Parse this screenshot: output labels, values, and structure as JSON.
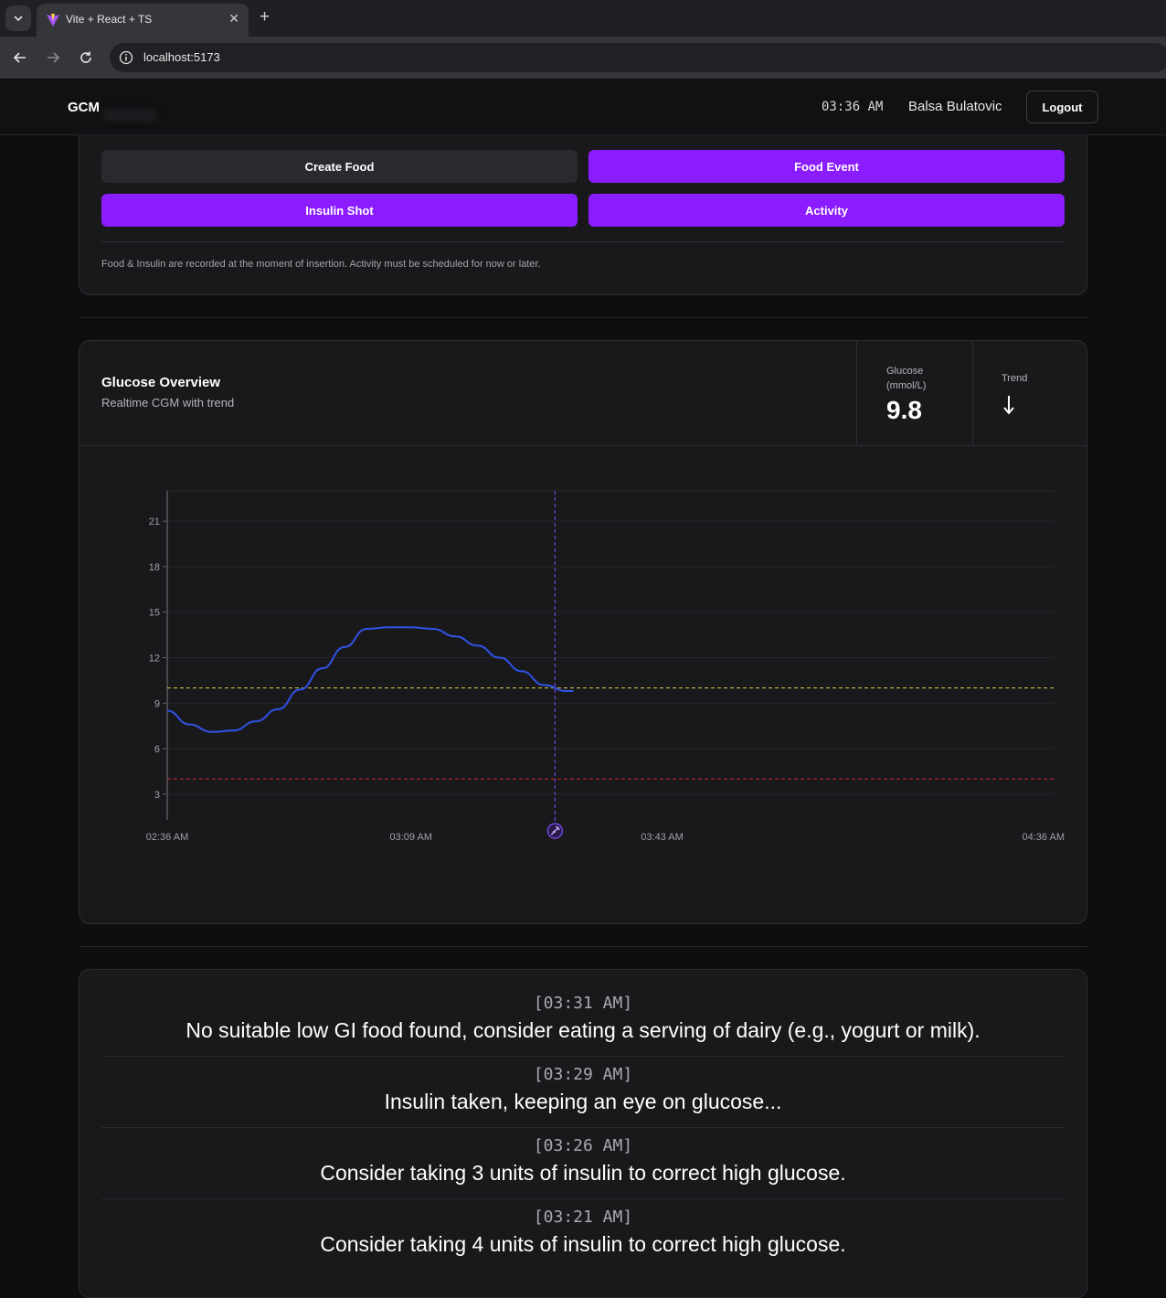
{
  "browser": {
    "tab_title": "Vite + React + TS",
    "url": "localhost:5173"
  },
  "header": {
    "brand": "GCM",
    "time": "03:36 AM",
    "user": "Balsa Bulatovic",
    "logout_label": "Logout"
  },
  "actions": {
    "create_food": "Create Food",
    "food_event": "Food Event",
    "insulin_shot": "Insulin Shot",
    "activity": "Activity",
    "note": "Food & Insulin are recorded at the moment of insertion. Activity must be scheduled for now or later."
  },
  "glucose_overview": {
    "title": "Glucose Overview",
    "subtitle": "Realtime CGM with trend",
    "glucose_label_line1": "Glucose",
    "glucose_label_line2": "(mmol/L)",
    "glucose_value": "9.8",
    "trend_label": "Trend",
    "trend_icon": "arrow-down-icon"
  },
  "chart_data": {
    "type": "line",
    "title": "",
    "xlabel": "",
    "ylabel": "",
    "x_tick_labels": [
      "02:36 AM",
      "03:09 AM",
      "03:43 AM",
      "04:36 AM"
    ],
    "x_tick_minutes": [
      0,
      33,
      67,
      120
    ],
    "y_ticks": [
      3,
      6,
      9,
      12,
      15,
      18,
      21
    ],
    "ylim": [
      1.3,
      23
    ],
    "xlim_minutes": [
      0,
      120
    ],
    "grid": true,
    "series": [
      {
        "color": "#2f52e6",
        "x_minutes": [
          0,
          3,
          6,
          9,
          12,
          15,
          18,
          21,
          24,
          27,
          30,
          33,
          36,
          39,
          42,
          45,
          48,
          51,
          54,
          55
        ],
        "values": [
          8.5,
          7.6,
          7.1,
          7.2,
          7.8,
          8.6,
          9.9,
          11.3,
          12.7,
          13.9,
          14.0,
          14.0,
          13.9,
          13.4,
          12.8,
          12.0,
          11.1,
          10.2,
          9.8,
          9.8
        ]
      }
    ],
    "reference_lines": [
      {
        "kind": "high",
        "value": 10,
        "color": "#e6c84a"
      },
      {
        "kind": "low",
        "value": 4,
        "color": "#d02a2a"
      }
    ],
    "now_marker": {
      "minutes": 52.5,
      "color": "#7c4dff",
      "icon": "syringe-icon"
    }
  },
  "log": [
    {
      "time": "[03:31 AM]",
      "message": "No suitable low GI food found, consider eating a serving of dairy (e.g., yogurt or milk)."
    },
    {
      "time": "[03:29 AM]",
      "message": "Insulin taken, keeping an eye on glucose..."
    },
    {
      "time": "[03:26 AM]",
      "message": "Consider taking 3 units of insulin to correct high glucose."
    },
    {
      "time": "[03:21 AM]",
      "message": "Consider taking 4 units of insulin to correct high glucose."
    }
  ]
}
